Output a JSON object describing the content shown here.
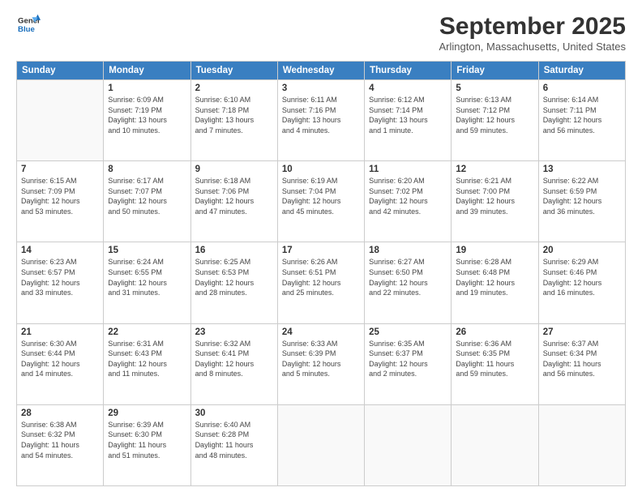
{
  "header": {
    "logo_general": "General",
    "logo_blue": "Blue",
    "month": "September 2025",
    "location": "Arlington, Massachusetts, United States"
  },
  "weekdays": [
    "Sunday",
    "Monday",
    "Tuesday",
    "Wednesday",
    "Thursday",
    "Friday",
    "Saturday"
  ],
  "weeks": [
    [
      {
        "day": "",
        "info": ""
      },
      {
        "day": "1",
        "info": "Sunrise: 6:09 AM\nSunset: 7:19 PM\nDaylight: 13 hours\nand 10 minutes."
      },
      {
        "day": "2",
        "info": "Sunrise: 6:10 AM\nSunset: 7:18 PM\nDaylight: 13 hours\nand 7 minutes."
      },
      {
        "day": "3",
        "info": "Sunrise: 6:11 AM\nSunset: 7:16 PM\nDaylight: 13 hours\nand 4 minutes."
      },
      {
        "day": "4",
        "info": "Sunrise: 6:12 AM\nSunset: 7:14 PM\nDaylight: 13 hours\nand 1 minute."
      },
      {
        "day": "5",
        "info": "Sunrise: 6:13 AM\nSunset: 7:12 PM\nDaylight: 12 hours\nand 59 minutes."
      },
      {
        "day": "6",
        "info": "Sunrise: 6:14 AM\nSunset: 7:11 PM\nDaylight: 12 hours\nand 56 minutes."
      }
    ],
    [
      {
        "day": "7",
        "info": "Sunrise: 6:15 AM\nSunset: 7:09 PM\nDaylight: 12 hours\nand 53 minutes."
      },
      {
        "day": "8",
        "info": "Sunrise: 6:17 AM\nSunset: 7:07 PM\nDaylight: 12 hours\nand 50 minutes."
      },
      {
        "day": "9",
        "info": "Sunrise: 6:18 AM\nSunset: 7:06 PM\nDaylight: 12 hours\nand 47 minutes."
      },
      {
        "day": "10",
        "info": "Sunrise: 6:19 AM\nSunset: 7:04 PM\nDaylight: 12 hours\nand 45 minutes."
      },
      {
        "day": "11",
        "info": "Sunrise: 6:20 AM\nSunset: 7:02 PM\nDaylight: 12 hours\nand 42 minutes."
      },
      {
        "day": "12",
        "info": "Sunrise: 6:21 AM\nSunset: 7:00 PM\nDaylight: 12 hours\nand 39 minutes."
      },
      {
        "day": "13",
        "info": "Sunrise: 6:22 AM\nSunset: 6:59 PM\nDaylight: 12 hours\nand 36 minutes."
      }
    ],
    [
      {
        "day": "14",
        "info": "Sunrise: 6:23 AM\nSunset: 6:57 PM\nDaylight: 12 hours\nand 33 minutes."
      },
      {
        "day": "15",
        "info": "Sunrise: 6:24 AM\nSunset: 6:55 PM\nDaylight: 12 hours\nand 31 minutes."
      },
      {
        "day": "16",
        "info": "Sunrise: 6:25 AM\nSunset: 6:53 PM\nDaylight: 12 hours\nand 28 minutes."
      },
      {
        "day": "17",
        "info": "Sunrise: 6:26 AM\nSunset: 6:51 PM\nDaylight: 12 hours\nand 25 minutes."
      },
      {
        "day": "18",
        "info": "Sunrise: 6:27 AM\nSunset: 6:50 PM\nDaylight: 12 hours\nand 22 minutes."
      },
      {
        "day": "19",
        "info": "Sunrise: 6:28 AM\nSunset: 6:48 PM\nDaylight: 12 hours\nand 19 minutes."
      },
      {
        "day": "20",
        "info": "Sunrise: 6:29 AM\nSunset: 6:46 PM\nDaylight: 12 hours\nand 16 minutes."
      }
    ],
    [
      {
        "day": "21",
        "info": "Sunrise: 6:30 AM\nSunset: 6:44 PM\nDaylight: 12 hours\nand 14 minutes."
      },
      {
        "day": "22",
        "info": "Sunrise: 6:31 AM\nSunset: 6:43 PM\nDaylight: 12 hours\nand 11 minutes."
      },
      {
        "day": "23",
        "info": "Sunrise: 6:32 AM\nSunset: 6:41 PM\nDaylight: 12 hours\nand 8 minutes."
      },
      {
        "day": "24",
        "info": "Sunrise: 6:33 AM\nSunset: 6:39 PM\nDaylight: 12 hours\nand 5 minutes."
      },
      {
        "day": "25",
        "info": "Sunrise: 6:35 AM\nSunset: 6:37 PM\nDaylight: 12 hours\nand 2 minutes."
      },
      {
        "day": "26",
        "info": "Sunrise: 6:36 AM\nSunset: 6:35 PM\nDaylight: 11 hours\nand 59 minutes."
      },
      {
        "day": "27",
        "info": "Sunrise: 6:37 AM\nSunset: 6:34 PM\nDaylight: 11 hours\nand 56 minutes."
      }
    ],
    [
      {
        "day": "28",
        "info": "Sunrise: 6:38 AM\nSunset: 6:32 PM\nDaylight: 11 hours\nand 54 minutes."
      },
      {
        "day": "29",
        "info": "Sunrise: 6:39 AM\nSunset: 6:30 PM\nDaylight: 11 hours\nand 51 minutes."
      },
      {
        "day": "30",
        "info": "Sunrise: 6:40 AM\nSunset: 6:28 PM\nDaylight: 11 hours\nand 48 minutes."
      },
      {
        "day": "",
        "info": ""
      },
      {
        "day": "",
        "info": ""
      },
      {
        "day": "",
        "info": ""
      },
      {
        "day": "",
        "info": ""
      }
    ]
  ]
}
